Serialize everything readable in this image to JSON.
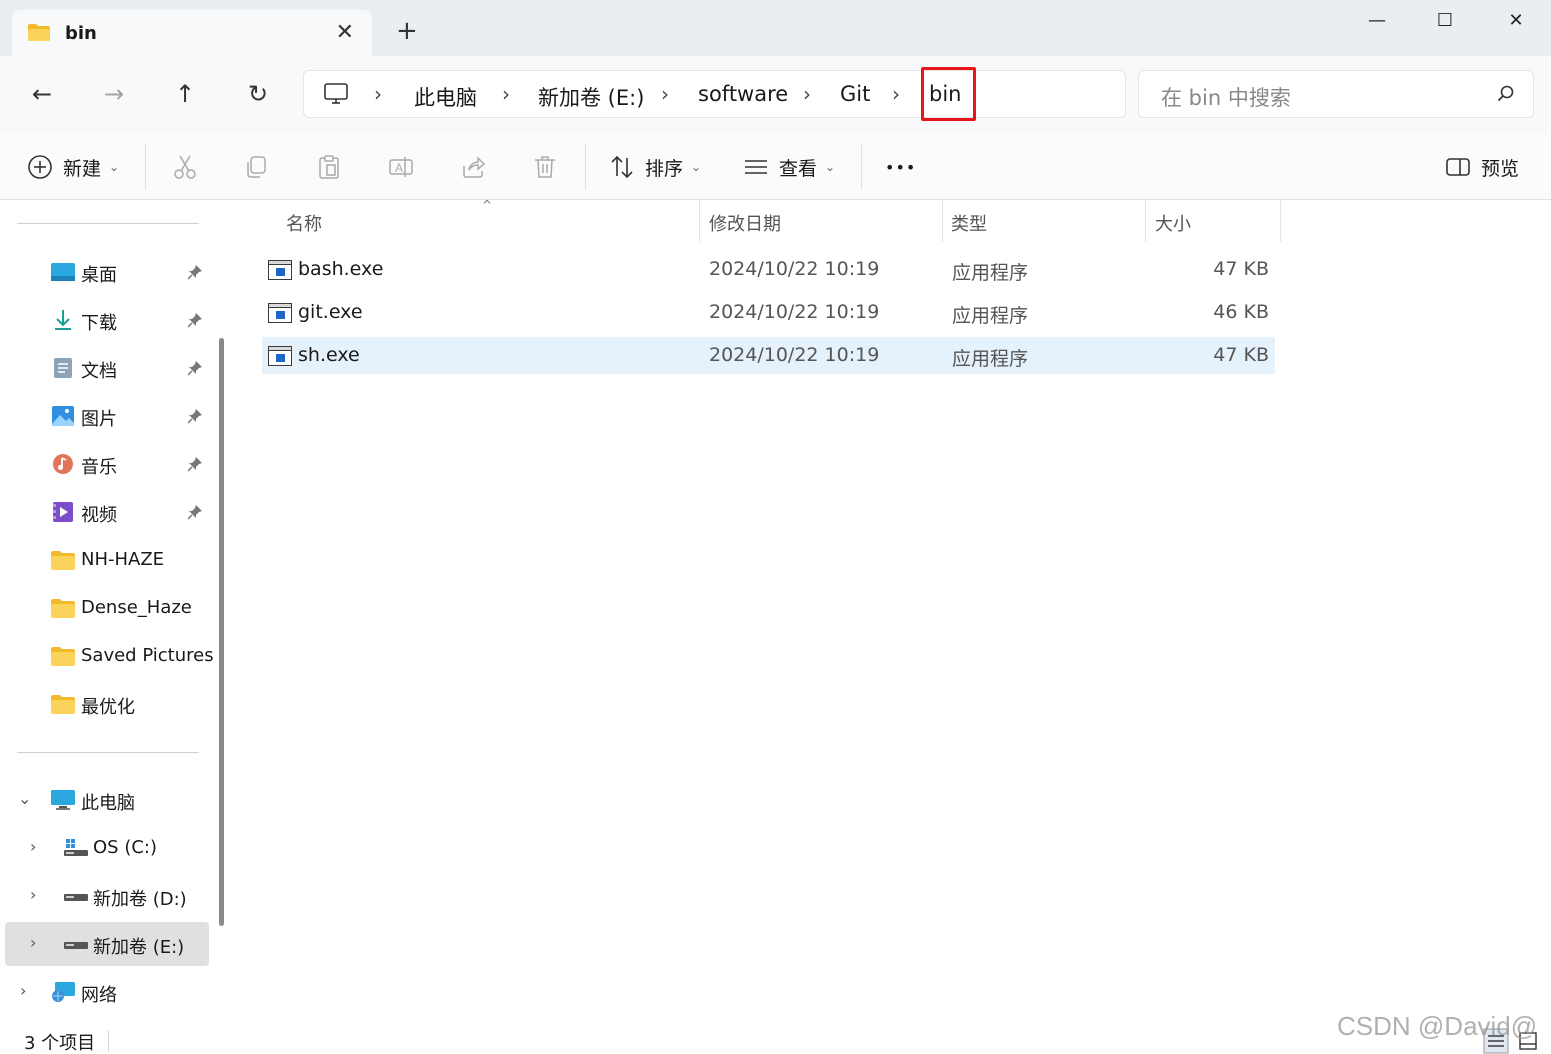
{
  "window": {
    "tab_title": "bin",
    "tab_close_glyph": "✕",
    "new_tab_glyph": "+",
    "minimize_glyph": "—",
    "maximize_glyph": "☐",
    "close_glyph": "✕"
  },
  "nav": {
    "back_glyph": "←",
    "forward_glyph": "→",
    "up_glyph": "↑",
    "refresh_glyph": "↻",
    "breadcrumbs": [
      "此电脑",
      "新加卷 (E:)",
      "software",
      "Git",
      "bin"
    ],
    "separator": "›",
    "search_placeholder": "在 bin 中搜索",
    "highlight_color": "#e8151b"
  },
  "toolbar": {
    "new_label": "新建",
    "sort_label": "排序",
    "view_label": "查看",
    "more_label": "•••",
    "preview_label": "预览",
    "chevron": "⌄"
  },
  "sidebar": {
    "quick_access": [
      {
        "label": "桌面",
        "icon": "desktop-icon",
        "pinned": true
      },
      {
        "label": "下载",
        "icon": "download-icon",
        "pinned": true
      },
      {
        "label": "文档",
        "icon": "document-icon",
        "pinned": true
      },
      {
        "label": "图片",
        "icon": "pictures-icon",
        "pinned": true
      },
      {
        "label": "音乐",
        "icon": "music-icon",
        "pinned": true
      },
      {
        "label": "视频",
        "icon": "video-icon",
        "pinned": true
      },
      {
        "label": "NH-HAZE",
        "icon": "folder-icon",
        "pinned": false
      },
      {
        "label": "Dense_Haze",
        "icon": "folder-icon",
        "pinned": false
      },
      {
        "label": "Saved Pictures",
        "icon": "folder-icon",
        "pinned": false
      },
      {
        "label": "最优化",
        "icon": "folder-icon",
        "pinned": false
      }
    ],
    "this_pc": {
      "label": "此电脑",
      "expand_glyph": "⌄"
    },
    "drives": [
      {
        "label": "OS (C:)",
        "icon": "windows-drive-icon"
      },
      {
        "label": "新加卷 (D:)",
        "icon": "drive-icon"
      },
      {
        "label": "新加卷 (E:)",
        "icon": "drive-icon",
        "selected": true
      }
    ],
    "network": {
      "label": "网络",
      "icon": "network-icon"
    },
    "collapse_glyph": "›"
  },
  "list": {
    "headers": {
      "name": "名称",
      "date": "修改日期",
      "type": "类型",
      "size": "大小"
    },
    "sort_glyph": "^",
    "rows": [
      {
        "name": "bash.exe",
        "date": "2024/10/22 10:19",
        "type": "应用程序",
        "size": "47 KB",
        "selected": false
      },
      {
        "name": "git.exe",
        "date": "2024/10/22 10:19",
        "type": "应用程序",
        "size": "46 KB",
        "selected": false
      },
      {
        "name": "sh.exe",
        "date": "2024/10/22 10:19",
        "type": "应用程序",
        "size": "47 KB",
        "selected": true
      }
    ]
  },
  "status": {
    "item_count": "3 个项目",
    "watermark": "CSDN @David@"
  },
  "colors": {
    "accent": "#0067c0",
    "selection": "#e5f1fb",
    "folder": "#f7c948"
  }
}
